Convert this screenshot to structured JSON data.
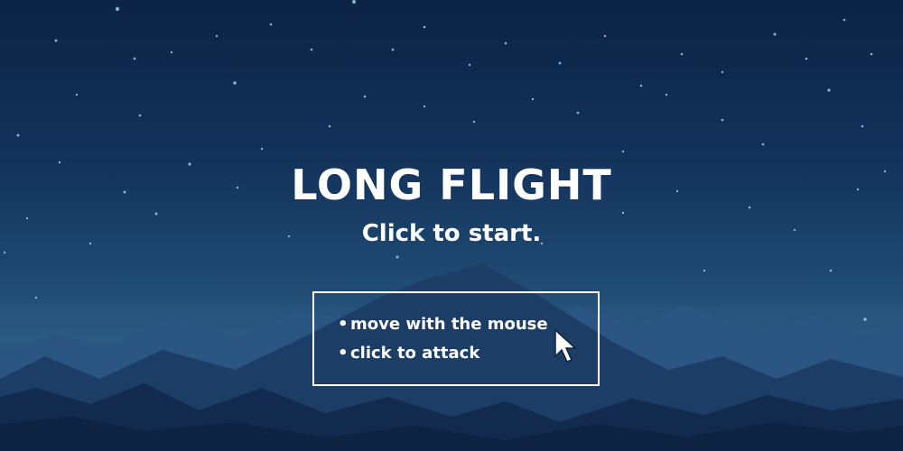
{
  "screen": {
    "title": "LONG FLIGHT",
    "prompt": "Click to start."
  },
  "instructions": [
    {
      "text": "move with the mouse"
    },
    {
      "text": "click to attack"
    }
  ],
  "icons": {
    "cursor": "mouse-pointer-icon"
  },
  "colors": {
    "sky_top": "#0c2344",
    "sky_bottom": "#2b5a82",
    "mountain_far": "#2b5582",
    "mountain_mid": "#1c3d66",
    "mountain_near": "#122a4d",
    "text": "#ffffff"
  }
}
